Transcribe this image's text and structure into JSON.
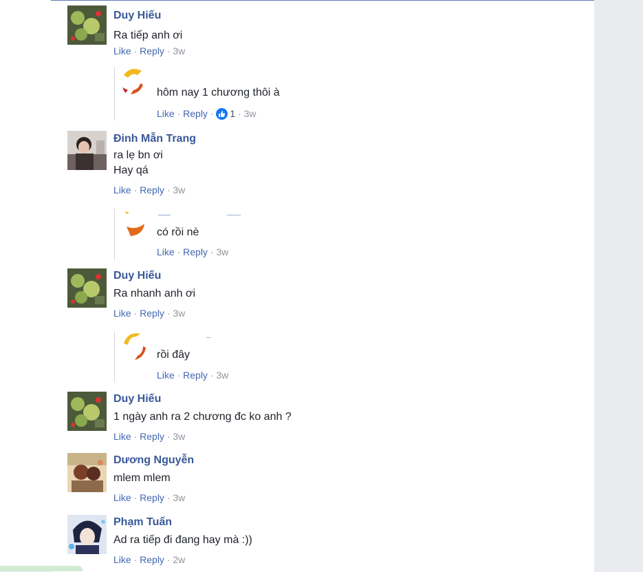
{
  "colors": {
    "name": "#385898",
    "link": "#4267b2",
    "meta": "#90949c",
    "text": "#1d2129",
    "like_badge": "#1877f2"
  },
  "actions": {
    "like": "Like",
    "reply": "Reply",
    "sep": "·"
  },
  "comments": [
    {
      "name": "Duy Hiếu",
      "lines": [
        "Ra tiếp anh ơi"
      ],
      "time": "3w",
      "reply": {
        "text": "hôm nay 1 chương thôi à",
        "time": "3w",
        "likes": "1"
      }
    },
    {
      "name": "Đinh Mẫn Trang",
      "lines": [
        "ra lẹ bn ơi",
        "Hay qá"
      ],
      "time": "3w",
      "reply": {
        "text": "có rồi nè",
        "time": "3w"
      }
    },
    {
      "name": "Duy Hiếu",
      "lines": [
        "Ra nhanh anh ơi"
      ],
      "time": "3w",
      "reply": {
        "text": "rồi đây",
        "time": "3w"
      }
    },
    {
      "name": "Duy Hiếu",
      "lines": [
        "1 ngày anh ra 2 chương đc ko anh ?"
      ],
      "time": "3w"
    },
    {
      "name": "Dương Nguyễn",
      "lines": [
        "mlem mlem"
      ],
      "time": "3w"
    },
    {
      "name": "Phạm Tuấn",
      "lines": [
        "Ad ra tiếp đi đang hay mà :))"
      ],
      "time": "2w"
    }
  ]
}
